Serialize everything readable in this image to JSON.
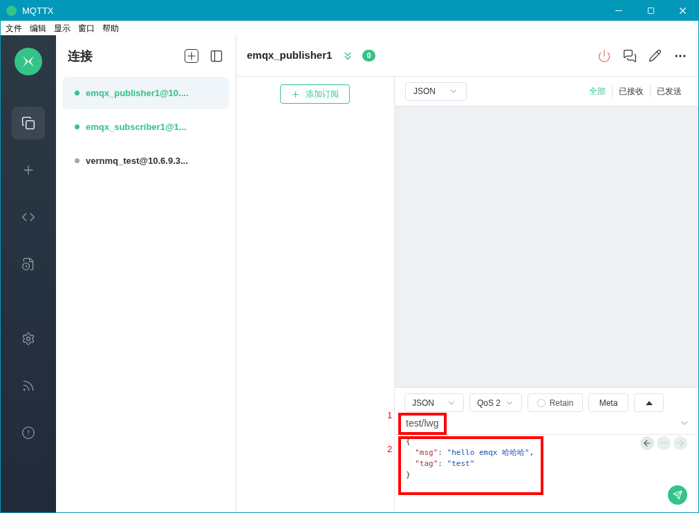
{
  "window": {
    "title": "MQTTX"
  },
  "menu": [
    "文件",
    "编辑",
    "显示",
    "窗口",
    "帮助"
  ],
  "rail": [
    {
      "kind": "connections",
      "selected": true
    },
    {
      "kind": "new",
      "selected": false
    },
    {
      "kind": "script",
      "selected": false
    },
    {
      "kind": "log",
      "selected": false
    },
    {
      "kind": "settings",
      "selected": false
    },
    {
      "kind": "feed",
      "selected": false
    },
    {
      "kind": "about",
      "selected": false
    }
  ],
  "connections": {
    "title": "连接",
    "items": [
      {
        "name": "emqx_publisher1@10....",
        "connected": true,
        "selected": true
      },
      {
        "name": "emqx_subscriber1@1...",
        "connected": true,
        "selected": false
      },
      {
        "name": "vernmq_test@10.6.9.3...",
        "connected": false,
        "selected": false
      }
    ]
  },
  "header": {
    "title": "emqx_publisher1",
    "count": "0"
  },
  "subscriptions": {
    "add_button": "添加订阅"
  },
  "messages": {
    "format": "JSON",
    "filters": [
      {
        "label": "全部",
        "selected": true
      },
      {
        "label": "已接收",
        "selected": false
      },
      {
        "label": "已发送",
        "selected": false
      }
    ]
  },
  "publish": {
    "format": "JSON",
    "qos": "QoS 2",
    "retain": {
      "label": "Retain",
      "checked": false
    },
    "meta": "Meta",
    "topic": "test/lwg",
    "code": [
      [
        {
          "kind": "punct",
          "text": "{"
        }
      ],
      [
        {
          "kind": "key",
          "text": "  \"msg\""
        },
        {
          "kind": "punct",
          "text": ": "
        },
        {
          "kind": "string",
          "text": "\"hello emqx 哈哈哈\""
        },
        {
          "kind": "punct",
          "text": ","
        }
      ],
      [
        {
          "kind": "key",
          "text": "  \"tag\""
        },
        {
          "kind": "punct",
          "text": ": "
        },
        {
          "kind": "string",
          "text": "\"test\""
        }
      ],
      [
        {
          "kind": "punct",
          "text": "}"
        }
      ]
    ]
  },
  "annotations": [
    {
      "label": "1"
    },
    {
      "label": "2"
    }
  ]
}
